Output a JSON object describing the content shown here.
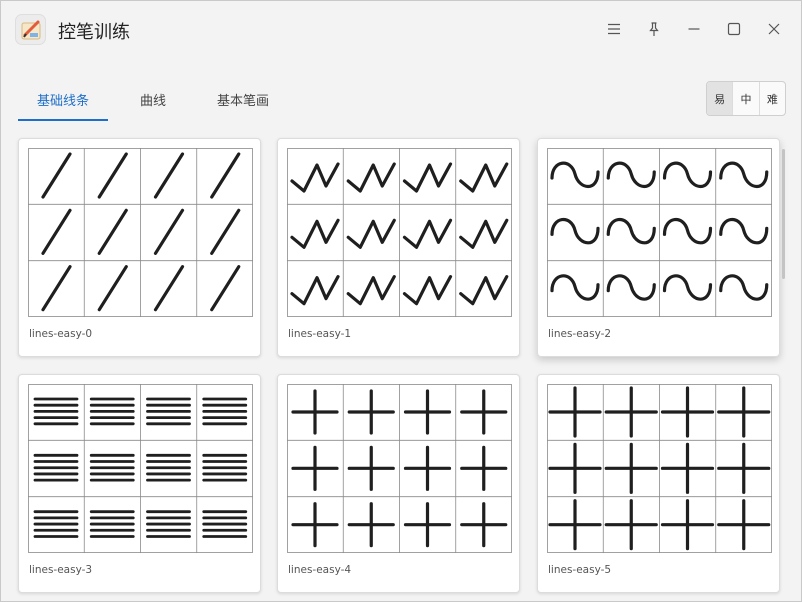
{
  "app": {
    "title": "控笔训练"
  },
  "tabs": [
    {
      "label": "基础线条",
      "active": true
    },
    {
      "label": "曲线",
      "active": false
    },
    {
      "label": "基本笔画",
      "active": false
    }
  ],
  "difficulty": [
    {
      "label": "易",
      "active": true
    },
    {
      "label": "中",
      "active": false
    },
    {
      "label": "难",
      "active": false
    }
  ],
  "window_controls": [
    "menu-icon",
    "pin-icon",
    "minimize-icon",
    "maximize-icon",
    "close-icon"
  ],
  "cards": [
    {
      "label": "lines-easy-0",
      "pattern": "slash"
    },
    {
      "label": "lines-easy-1",
      "pattern": "zigzag"
    },
    {
      "label": "lines-easy-2",
      "pattern": "wave"
    },
    {
      "label": "lines-easy-3",
      "pattern": "hlines"
    },
    {
      "label": "lines-easy-4",
      "pattern": "cross"
    },
    {
      "label": "lines-easy-5",
      "pattern": "bigcross"
    }
  ],
  "colors": {
    "accent": "#1e6fc9",
    "stroke": "#1f1f1f",
    "grid": "#8a8a8a"
  }
}
